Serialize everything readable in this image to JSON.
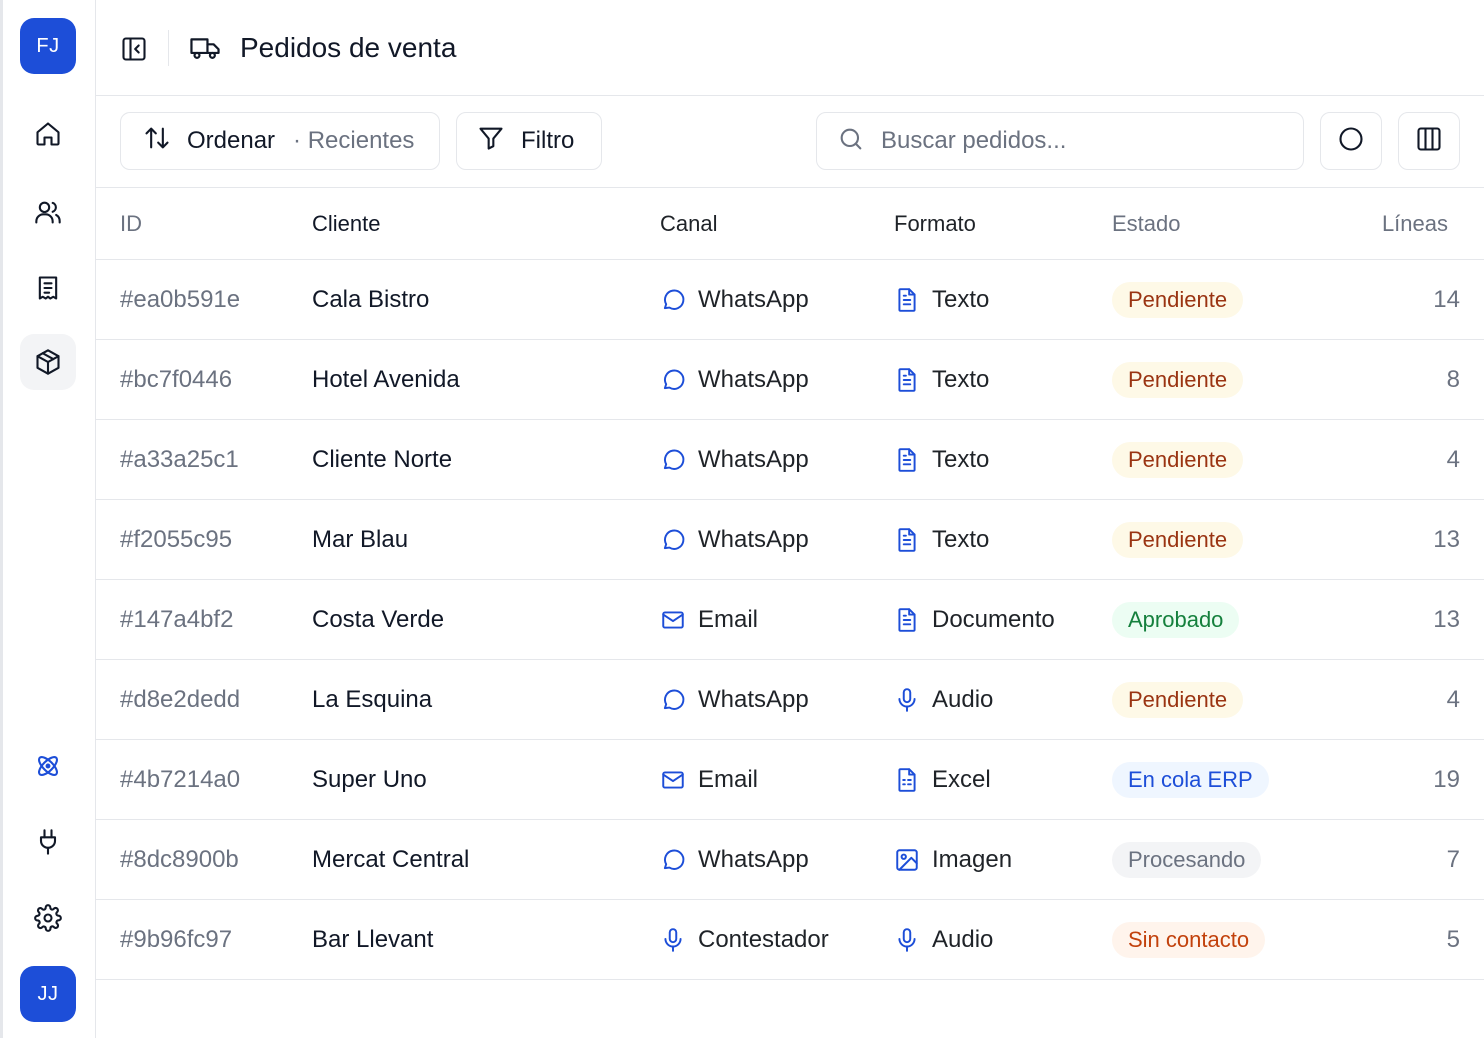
{
  "sidebar": {
    "top_avatar": "FJ",
    "bottom_avatar": "JJ",
    "nav": [
      "home-icon",
      "users-icon",
      "receipt-icon",
      "package-icon",
      "atom-icon",
      "plug-icon",
      "gear-icon"
    ],
    "active": "package-icon"
  },
  "header": {
    "title": "Pedidos de venta",
    "icons": [
      "sidebar-toggle-icon",
      "truck-icon"
    ]
  },
  "toolbar": {
    "sort_label": "Ordenar",
    "sort_value": "· Recientes",
    "filter_label": "Filtro",
    "search_placeholder": "Buscar pedidos..."
  },
  "table": {
    "columns": [
      "ID",
      "Cliente",
      "Canal",
      "Formato",
      "Estado",
      "Líneas"
    ],
    "rows": [
      {
        "id": "#ea0b591e",
        "cliente": "Cala Bistro",
        "canal": "WhatsApp",
        "canal_icon": "chat",
        "formato": "Texto",
        "formato_icon": "doc",
        "estado": "Pendiente",
        "estado_tone": "pend",
        "lineas": "14"
      },
      {
        "id": "#bc7f0446",
        "cliente": "Hotel Avenida",
        "canal": "WhatsApp",
        "canal_icon": "chat",
        "formato": "Texto",
        "formato_icon": "doc",
        "estado": "Pendiente",
        "estado_tone": "pend",
        "lineas": "8"
      },
      {
        "id": "#a33a25c1",
        "cliente": "Cliente Norte",
        "canal": "WhatsApp",
        "canal_icon": "chat",
        "formato": "Texto",
        "formato_icon": "doc",
        "estado": "Pendiente",
        "estado_tone": "pend",
        "lineas": "4"
      },
      {
        "id": "#f2055c95",
        "cliente": "Mar Blau",
        "canal": "WhatsApp",
        "canal_icon": "chat",
        "formato": "Texto",
        "formato_icon": "doc",
        "estado": "Pendiente",
        "estado_tone": "pend",
        "lineas": "13"
      },
      {
        "id": "#147a4bf2",
        "cliente": "Costa Verde",
        "canal": "Email",
        "canal_icon": "mail",
        "formato": "Documento",
        "formato_icon": "doc",
        "estado": "Aprobado",
        "estado_tone": "aprob",
        "lineas": "13"
      },
      {
        "id": "#d8e2dedd",
        "cliente": "La Esquina",
        "canal": "WhatsApp",
        "canal_icon": "chat",
        "formato": "Audio",
        "formato_icon": "mic",
        "estado": "Pendiente",
        "estado_tone": "pend",
        "lineas": "4"
      },
      {
        "id": "#4b7214a0",
        "cliente": "Super Uno",
        "canal": "Email",
        "canal_icon": "mail",
        "formato": "Excel",
        "formato_icon": "sheet",
        "estado": "En cola ERP",
        "estado_tone": "erp",
        "lineas": "19"
      },
      {
        "id": "#8dc8900b",
        "cliente": "Mercat Central",
        "canal": "WhatsApp",
        "canal_icon": "chat",
        "formato": "Imagen",
        "formato_icon": "image",
        "estado": "Procesando",
        "estado_tone": "proc",
        "lineas": "7"
      },
      {
        "id": "#9b96fc97",
        "cliente": "Bar Llevant",
        "canal": "Contestador",
        "canal_icon": "mic",
        "formato": "Audio",
        "formato_icon": "mic",
        "estado": "Sin contacto",
        "estado_tone": "sin",
        "lineas": "5"
      }
    ]
  },
  "colors": {
    "accent": "#1d4ed8",
    "pendiente": "#9a3412",
    "aprobado": "#15803d",
    "erp": "#1d4ed8",
    "procesando": "#6b7280",
    "sin_contacto": "#c2410c"
  }
}
